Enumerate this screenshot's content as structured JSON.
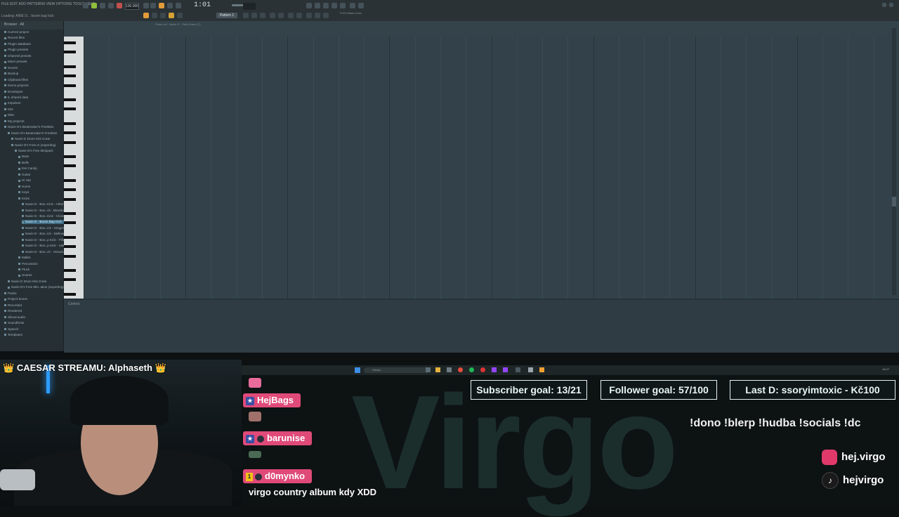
{
  "daw": {
    "menu_text": "FILE EDIT ADD PATTERNS VIEW OPTIONS TOOLS HELP",
    "hint_text": "Loading: ANIE D... boom bap kick",
    "tempo": "130.000",
    "clock": "1:01",
    "clock_sub": ":00",
    "pattern": "Pattern 1",
    "song_info": "FLEX Bass Lines",
    "piano_roll_path": "Piano roll · Navie D - Retro Bass (C)",
    "browser_title": "Browser · All",
    "control_label": "Control",
    "icon_names": [
      "play-icon",
      "stop-icon",
      "record-icon",
      "snap-icon",
      "magnet-icon",
      "pencil-icon",
      "mixer-icon",
      "piano-roll-icon",
      "playlist-icon",
      "channel-rack-icon",
      "browser-icon",
      "plugin-icon"
    ]
  },
  "browser": {
    "items": [
      {
        "label": "Current project",
        "level": 0,
        "highlight": false
      },
      {
        "label": "Recent files",
        "level": 0,
        "highlight": false
      },
      {
        "label": "Plugin database",
        "level": 0,
        "highlight": false
      },
      {
        "label": "Plugin presets",
        "level": 0,
        "highlight": false
      },
      {
        "label": "Channel presets",
        "level": 0,
        "highlight": false
      },
      {
        "label": "Mixer presets",
        "level": 0,
        "highlight": false
      },
      {
        "label": "Scores",
        "level": 0,
        "highlight": false
      },
      {
        "label": "Backup",
        "level": 0,
        "highlight": false
      },
      {
        "label": "Clipboard files",
        "level": 0,
        "highlight": false
      },
      {
        "label": "Demo projects",
        "level": 0,
        "highlight": false
      },
      {
        "label": "Envelopes",
        "level": 0,
        "highlight": false
      },
      {
        "label": "IL shared data",
        "level": 0,
        "highlight": false
      },
      {
        "label": "Impulses",
        "level": 0,
        "highlight": false
      },
      {
        "label": "Kits",
        "level": 0,
        "highlight": false
      },
      {
        "label": "Misc",
        "level": 0,
        "highlight": false
      },
      {
        "label": "My projects",
        "level": 0,
        "highlight": false
      },
      {
        "label": "Navie D's Beatmaker's Freebies",
        "level": 0,
        "highlight": false
      },
      {
        "label": "Navie D's Beatmaker's Freebies",
        "level": 1,
        "highlight": false
      },
      {
        "label": "Navie D Drum Kits Crate",
        "level": 2,
        "highlight": false
      },
      {
        "label": "Navie D's Free.m (exporting)",
        "level": 2,
        "highlight": false
      },
      {
        "label": "Navie D's Free Minipack",
        "level": 3,
        "highlight": false
      },
      {
        "label": "Bass",
        "level": 4,
        "highlight": false
      },
      {
        "label": "Bells",
        "level": 4,
        "highlight": false
      },
      {
        "label": "Ear Candy",
        "level": 4,
        "highlight": false
      },
      {
        "label": "Guitar",
        "level": 4,
        "highlight": false
      },
      {
        "label": "Hi Hat",
        "level": 4,
        "highlight": false
      },
      {
        "label": "Horns",
        "level": 4,
        "highlight": false
      },
      {
        "label": "Keys",
        "level": 4,
        "highlight": false
      },
      {
        "label": "Kicks",
        "level": 4,
        "highlight": false
      },
      {
        "label": "Navie D - Boo..Kick - Athena",
        "level": 5,
        "highlight": false
      },
      {
        "label": "Navie D - Boo..ck - Blowdown",
        "level": 5,
        "highlight": false
      },
      {
        "label": "Navie D - Boo..Kick - Clover",
        "level": 5,
        "highlight": false
      },
      {
        "label": "Navie D - Boom Bap Kick - Fuze",
        "level": 5,
        "highlight": true
      },
      {
        "label": "Navie D - Boo..ick - Kingpin",
        "level": 5,
        "highlight": false
      },
      {
        "label": "Navie D - Boo..ick - Mellow",
        "level": 5,
        "highlight": false
      },
      {
        "label": "Navie D - Boo..p Kick - Pillar",
        "level": 5,
        "highlight": false
      },
      {
        "label": "Navie D - Boo..p Kick - Vale",
        "level": 5,
        "highlight": false
      },
      {
        "label": "Navie D - Boo..ck - Vesuvius",
        "level": 5,
        "highlight": false
      },
      {
        "label": "Mallet",
        "level": 4,
        "highlight": false
      },
      {
        "label": "Percussion",
        "level": 4,
        "highlight": false
      },
      {
        "label": "Pluck",
        "level": 4,
        "highlight": false
      },
      {
        "label": "Snares",
        "level": 4,
        "highlight": false
      },
      {
        "label": "Navie D Drum Kits Crate",
        "level": 1,
        "highlight": false
      },
      {
        "label": "Navie D's Free Min..ation (exporting)",
        "level": 1,
        "highlight": false
      },
      {
        "label": "Packs",
        "level": 0,
        "highlight": false
      },
      {
        "label": "Project bones",
        "level": 0,
        "highlight": false
      },
      {
        "label": "Recorded",
        "level": 0,
        "highlight": false
      },
      {
        "label": "Rendered",
        "level": 0,
        "highlight": false
      },
      {
        "label": "Sliced audio",
        "level": 0,
        "highlight": false
      },
      {
        "label": "Soundfonts",
        "level": 0,
        "highlight": false
      },
      {
        "label": "Speech",
        "level": 0,
        "highlight": false
      },
      {
        "label": "Templates",
        "level": 0,
        "highlight": false
      }
    ]
  },
  "taskbar": {
    "search_placeholder": "Hledat",
    "clock": "18:47"
  },
  "stream": {
    "webcam_title": "CAESAR STREAMU: Alphaseth",
    "crown": "👑",
    "goals": [
      {
        "label": "Subscriber goal: 13/21"
      },
      {
        "label": "Follower goal: 57/100"
      },
      {
        "label": "Last D: ssoryimtoxic - Kč100"
      }
    ],
    "commands": "!dono !blerp !hudba !socials !dc",
    "socials": [
      {
        "icon": "instagram-icon",
        "handle": "hej.virgo"
      },
      {
        "icon": "tiktok-icon",
        "handle": "hejvirgo"
      }
    ],
    "background_word": "Virgo",
    "chat": [
      {
        "user": "HejBags",
        "badge": "sub-badge"
      },
      {
        "user": "barunise",
        "badge": "sub-badge"
      },
      {
        "user": "d0mynko",
        "badge": "sub-badge",
        "rank": "1"
      }
    ],
    "chat_message": "virgo country album kdy XDD",
    "accent": "#e04a78",
    "goal_border": "#e8f3f3"
  }
}
